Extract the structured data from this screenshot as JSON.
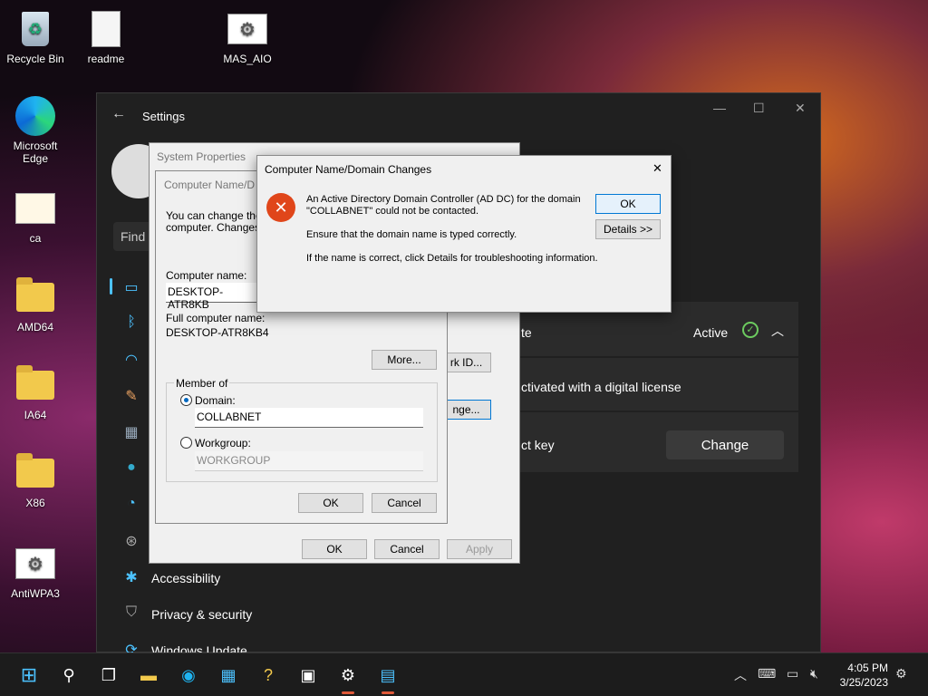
{
  "desktop": {
    "icons": [
      {
        "label": "Recycle Bin"
      },
      {
        "label": "readme"
      },
      {
        "label": "MAS_AIO"
      },
      {
        "label": "Microsoft Edge"
      },
      {
        "label": "ca"
      },
      {
        "label": "AMD64"
      },
      {
        "label": "IA64"
      },
      {
        "label": "X86"
      },
      {
        "label": "AntiWPA3"
      }
    ]
  },
  "settings": {
    "title": "Settings",
    "search_placeholder": "Find",
    "nav": {
      "accessibility": "Accessibility",
      "privacy": "Privacy & security",
      "update": "Windows Update"
    },
    "activation": {
      "state_label": "te",
      "state_value": "Active",
      "license_text": "ctivated with a digital license",
      "product_key_label": "ct key",
      "change_button": "Change"
    }
  },
  "system_properties": {
    "title": "System Properties",
    "network_id_button": "rk ID...",
    "change_button": "nge...",
    "ok": "OK",
    "cancel": "Cancel",
    "apply": "Apply"
  },
  "computer_name_changes": {
    "title": "Computer Name/D",
    "intro": "You can change the",
    "intro2": "computer. Changes m",
    "computer_name_label": "Computer name:",
    "computer_name_value": "DESKTOP-ATR8KB",
    "full_name_label": "Full computer name:",
    "full_name_value": "DESKTOP-ATR8KB4",
    "more_button": "More...",
    "member_of_label": "Member of",
    "domain_label": "Domain:",
    "domain_value": "COLLABNET",
    "workgroup_label": "Workgroup:",
    "workgroup_value": "WORKGROUP",
    "ok": "OK",
    "cancel": "Cancel"
  },
  "error_dialog": {
    "title": "Computer Name/Domain Changes",
    "close": "✕",
    "line1": "An Active Directory Domain Controller (AD DC) for the domain",
    "line2": "\"COLLABNET\" could not be contacted.",
    "line3": "Ensure that the domain name is typed correctly.",
    "line4": "If the name is correct, click Details for troubleshooting information.",
    "ok_button": "OK",
    "details_button": "Details >>"
  },
  "taskbar": {
    "time": "4:05 PM",
    "date": "3/25/2023"
  },
  "colors": {
    "accent": "#0078d4",
    "error": "#e0461a",
    "active_check": "#6ccb5f"
  }
}
